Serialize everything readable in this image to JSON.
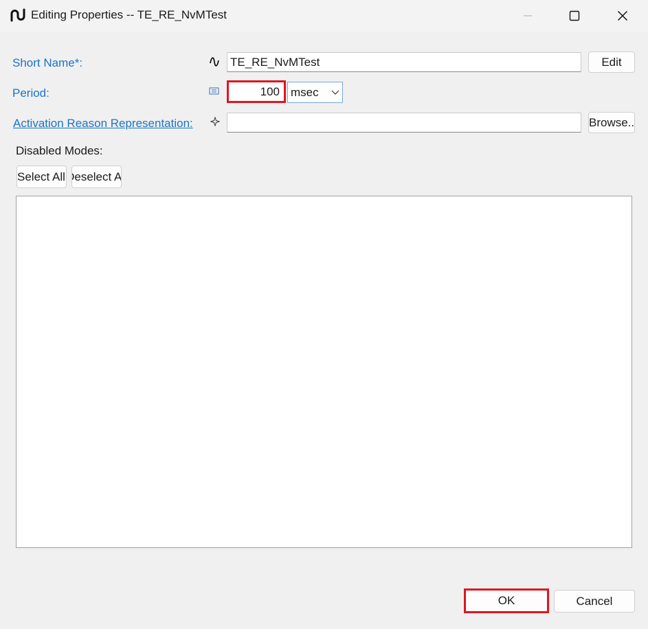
{
  "window": {
    "title": "Editing Properties -- TE_RE_NvMTest",
    "icon": "runnable-wave-icon",
    "controls": [
      "minimize-icon",
      "maximize-icon",
      "close-icon"
    ]
  },
  "form": {
    "short_name": {
      "label": "Short Name*:",
      "value": "TE_RE_NvMTest",
      "edit_label": "Edit",
      "icon": "wave-icon"
    },
    "period": {
      "label": "Period:",
      "value": "100",
      "unit": "msec",
      "icon": "numeric-icon"
    },
    "activation_reason": {
      "label": "Activation Reason Representation:",
      "value": "",
      "browse_label": "Browse...",
      "icon": "reference-icon"
    },
    "disabled_modes": {
      "label": "Disabled Modes:",
      "select_all_label": "Select All",
      "deselect_all_label": "Deselect All",
      "items": []
    }
  },
  "footer": {
    "ok_label": "OK",
    "cancel_label": "Cancel"
  },
  "colors": {
    "link": "#1a73c8",
    "highlight": "#e0141e",
    "background": "#f0f0f0"
  }
}
